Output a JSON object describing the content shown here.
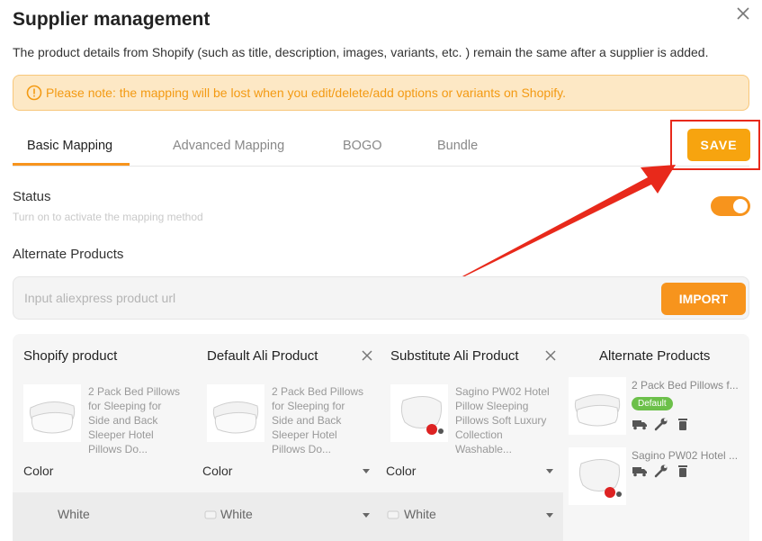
{
  "dialog": {
    "title": "Supplier management",
    "description": "The product details from Shopify (such as title, description, images, variants, etc. ) remain the same after a supplier is added.",
    "notice": "Please note: the mapping will be lost when you edit/delete/add options or variants on Shopify.",
    "close_icon": "close-icon"
  },
  "tabs": {
    "items": [
      "Basic Mapping",
      "Advanced Mapping",
      "BOGO",
      "Bundle"
    ],
    "active": "Basic Mapping",
    "save_label": "SAVE"
  },
  "status": {
    "label": "Status",
    "sublabel": "Turn on to activate the mapping method",
    "enabled": true
  },
  "alternate": {
    "title": "Alternate Products",
    "url_placeholder": "Input aliexpress product url",
    "import_label": "IMPORT"
  },
  "table": {
    "headers": [
      "Shopify product",
      "Default Ali Product",
      "Substitute Ali Product",
      "Alternate Products"
    ],
    "shopify_product": "2 Pack Bed Pillows for Sleeping for Side and Back Sleeper Hotel Pillows Do...",
    "default_product": "2 Pack Bed Pillows for Sleeping for Side and Back Sleeper Hotel Pillows Do...",
    "substitute_product": "Sagino PW02 Hotel Pillow Sleeping Pillows Soft Luxury Collection Washable...",
    "option_label": "Color",
    "default_option": "Color",
    "substitute_option": "Color",
    "shopify_value": "White",
    "default_value": "White",
    "substitute_value": "White"
  },
  "alternate_panel": {
    "items": [
      {
        "name": "2 Pack Bed Pillows f...",
        "badge": "Default"
      },
      {
        "name": "Sagino PW02 Hotel ..."
      }
    ]
  },
  "colors": {
    "accent": "#f7941d",
    "save": "#f7a40f",
    "notice_bg": "#fde8c5",
    "notice_text": "#f39a13",
    "annotation_red": "#e8291b",
    "badge_green": "#6cc04a"
  }
}
